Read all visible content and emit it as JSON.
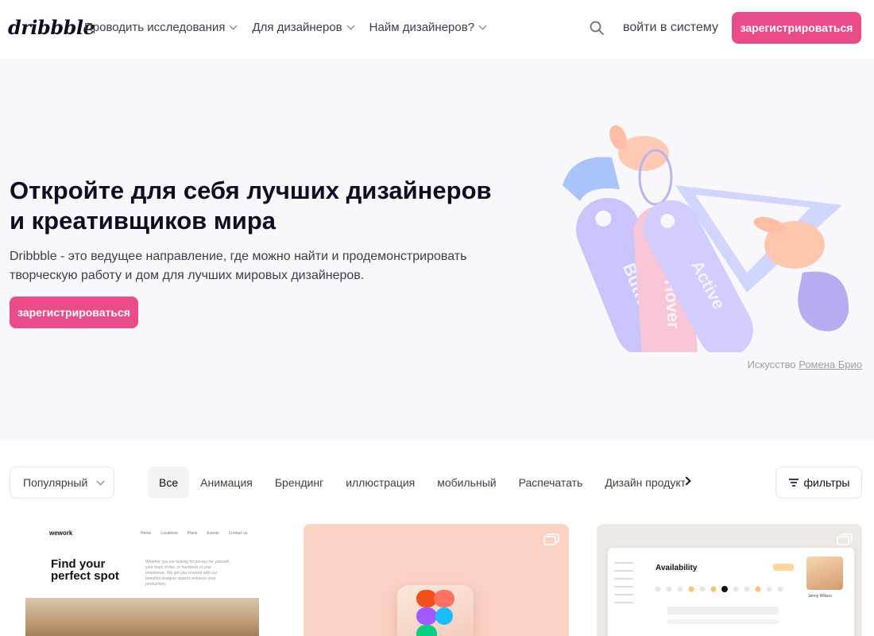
{
  "header": {
    "logo": "dribbble",
    "nav": [
      {
        "label": "Проводить исследования"
      },
      {
        "label": "Для дизайнеров"
      },
      {
        "label": "Найм дизайнеров?"
      }
    ],
    "search_icon": "search-icon",
    "login_label": "войти в систему",
    "signup_label": "зарегистрироваться"
  },
  "hero": {
    "title_line1": "Откройте для себя лучших дизайнеров",
    "title_line2": "и креативщиков мира",
    "desc_line1": "Dribbble - это ведущее направление, где можно найти и продемонстрировать",
    "desc_line2": "творческую работу и дом для лучших мировых дизайнеров.",
    "signup_label": "зарегистрироваться",
    "art_tags": [
      "Button",
      "Hover",
      "Active"
    ],
    "credit_prefix": "Искусство",
    "credit_author": "Ромена Брио"
  },
  "filters": {
    "sort_label": "Популярный",
    "categories": [
      "Все",
      "Анимация",
      "Брендинг",
      "иллюстрация",
      "мобильный",
      "Распечатать",
      "Дизайн продукта"
    ],
    "active_category": "Все",
    "filters_label": "фильтры"
  },
  "shots": [
    {
      "logo": "wework",
      "nav": [
        "Home",
        "Locations",
        "Plans",
        "Events",
        "Contact us"
      ],
      "title": "Find your perfect spot",
      "text": "Whether you are looking for privacy for yourself, your team of five, or hundreds of your employees. We got you covered with our beautiful designer spaces enhance your productivity."
    },
    {
      "icon": "figma-logo-icon"
    },
    {
      "title": "Availability",
      "name": "Jenny Wilson"
    }
  ],
  "colors": {
    "accent": "#ea4c89",
    "hero_bg": "#f8f7fc",
    "text": "#0d0c22"
  }
}
